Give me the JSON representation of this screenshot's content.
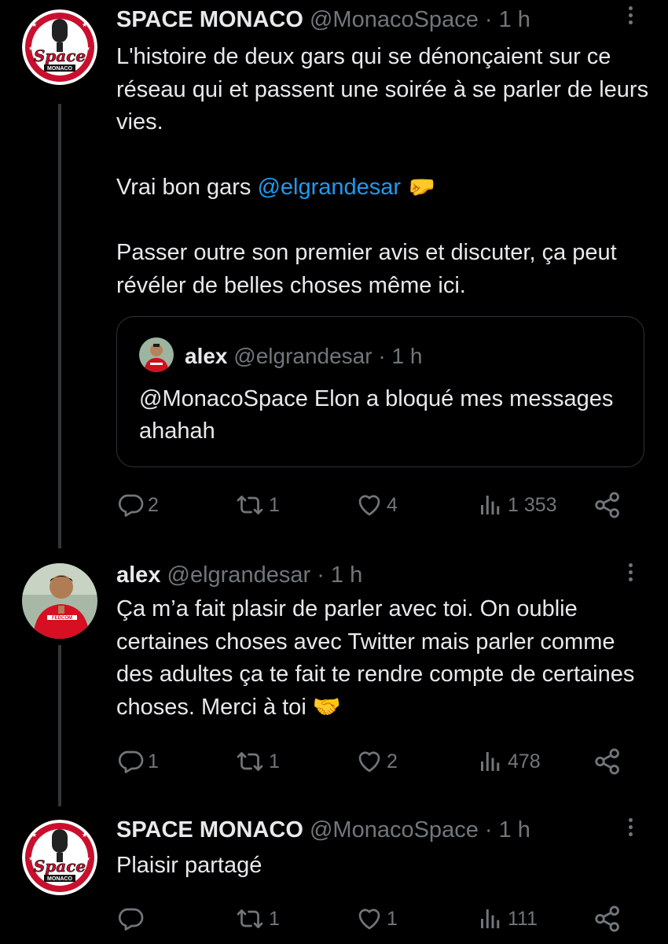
{
  "tweets": [
    {
      "name": "SPACE MONACO",
      "handle": "@MonacoSpace",
      "sep": "·",
      "time": "1 h",
      "avatar_text": [
        "Space",
        "MONACO"
      ],
      "text1": "L'histoire de deux gars qui se dénonçaient sur ce réseau qui et passent une soirée à se parler de leurs vies.",
      "text2_prefix": "Vrai bon gars ",
      "text2_mention": "@elgrandesar",
      "text2_emoji": "🤛",
      "text3": "Passer outre son premier avis et discuter, ça peut révéler de belles choses même ici.",
      "quote": {
        "name": "alex",
        "handle": "@elgrandesar",
        "sep": "·",
        "time": "1 h",
        "text": "@MonacoSpace Elon a bloqué mes messages ahahah"
      },
      "actions": {
        "replies": "2",
        "reposts": "1",
        "likes": "4",
        "views": "1 353"
      }
    },
    {
      "name": "alex",
      "handle": "@elgrandesar",
      "sep": "·",
      "time": "1 h",
      "text": "Ça m’a fait plasir de parler avec toi. On oublie certaines choses avec Twitter mais parler comme des adultes ça te fait te rendre compte de certaines choses. Merci à toi 🤝",
      "actions": {
        "replies": "1",
        "reposts": "1",
        "likes": "2",
        "views": "478"
      }
    },
    {
      "name": "SPACE MONACO",
      "handle": "@MonacoSpace",
      "sep": "·",
      "time": "1 h",
      "avatar_text": [
        "Space",
        "MONACO"
      ],
      "text": "Plaisir partagé",
      "actions": {
        "replies": "",
        "reposts": "1",
        "likes": "1",
        "views": "111"
      }
    }
  ],
  "colors": {
    "background": "#000000",
    "text": "#e7e9ea",
    "muted": "#71767b",
    "link": "#1d9bf0",
    "divider": "#2f3336"
  }
}
